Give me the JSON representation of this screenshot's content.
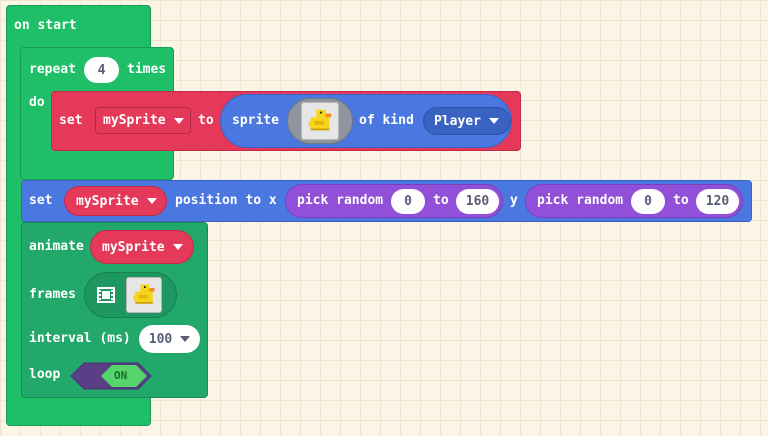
{
  "on_start": {
    "label": "on start"
  },
  "repeat": {
    "label": "repeat",
    "count": "4",
    "times_label": "times",
    "do_label": "do"
  },
  "set_sprite": {
    "set_label": "set",
    "variable": "mySprite",
    "to_label": "to",
    "sprite_label": "sprite",
    "sprite_icon": "duck-sprite-icon",
    "of_kind_label": "of kind",
    "kind": "Player"
  },
  "set_position": {
    "set_label": "set",
    "variable": "mySprite",
    "position_label": "position to x",
    "random1": {
      "label": "pick random",
      "min": "0",
      "to_label": "to",
      "max": "160"
    },
    "y_label": "y",
    "random2": {
      "label": "pick random",
      "min": "0",
      "to_label": "to",
      "max": "120"
    }
  },
  "animate": {
    "label": "animate",
    "variable": "mySprite",
    "frames_label": "frames",
    "film_icon": "film-icon",
    "interval_label": "interval (ms)",
    "interval_value": "100",
    "loop_label": "loop",
    "loop_state": "ON"
  },
  "colors": {
    "loops_green": "#1fbf68",
    "animation_green": "#23a86b",
    "variables_red": "#e5395a",
    "sprites_blue": "#4b78e0",
    "math_purple": "#9250d8"
  }
}
